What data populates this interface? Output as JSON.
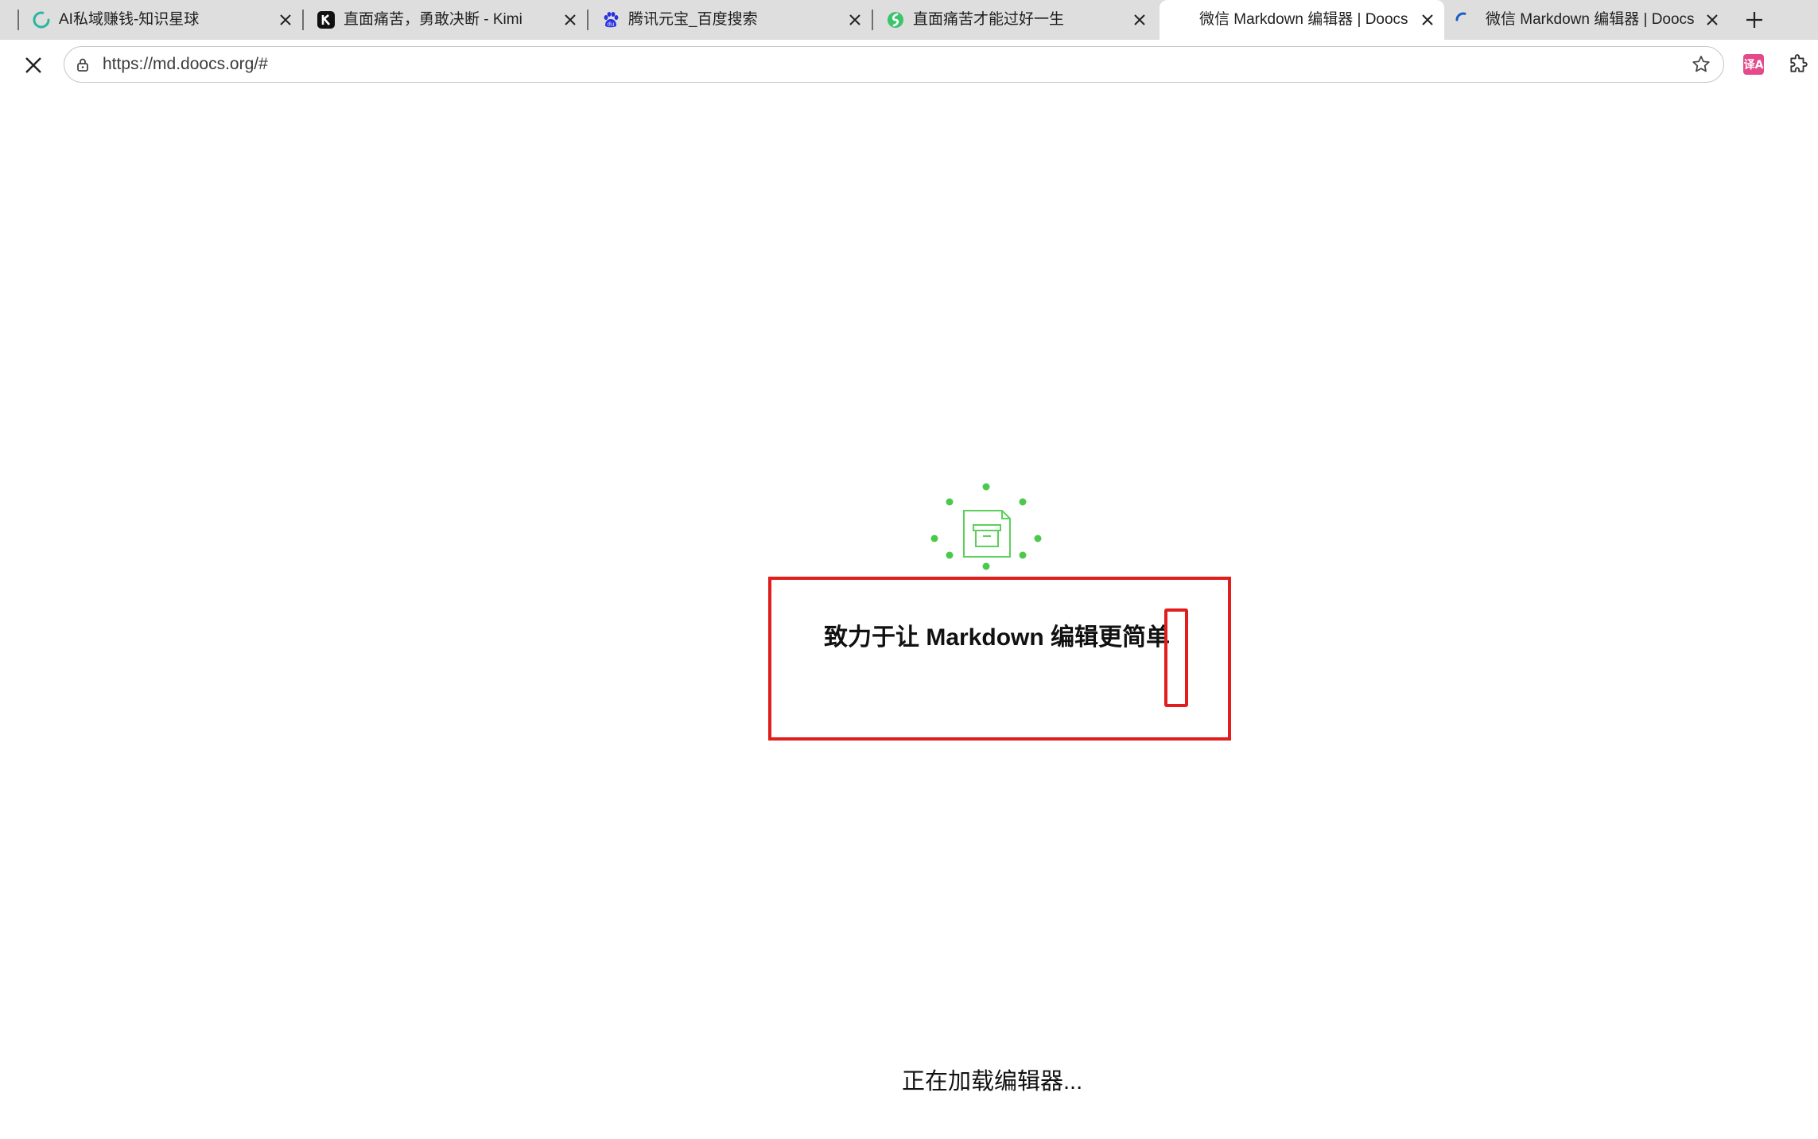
{
  "browser": {
    "tabs": [
      {
        "title": "AI私域赚钱-知识星球",
        "favicon": "spinner-icon",
        "active": false
      },
      {
        "title": "直面痛苦，勇敢决断 - Kimi",
        "favicon": "kimi-k-icon",
        "active": false
      },
      {
        "title": "腾讯元宝_百度搜索",
        "favicon": "baidu-paw-icon",
        "active": false
      },
      {
        "title": "直面痛苦才能过好一生",
        "favicon": "yuanbao-icon",
        "active": false
      },
      {
        "title": "微信 Markdown 编辑器 | Doocs 开",
        "favicon": "none",
        "active": true
      },
      {
        "title": "微信 Markdown 编辑器 | Doocs 开",
        "favicon": "loading-spinner-icon",
        "active": false
      }
    ],
    "address": {
      "url": "https://md.doocs.org/#"
    },
    "extension_translate_label": "译A",
    "colors": {
      "tabstrip_bg": "#dedede",
      "accent_green": "#52c41a",
      "highlight_red": "#e11d1d"
    }
  },
  "page": {
    "headline": "致力于让 Markdown 编辑更简单",
    "status": "正在加载编辑器..."
  }
}
